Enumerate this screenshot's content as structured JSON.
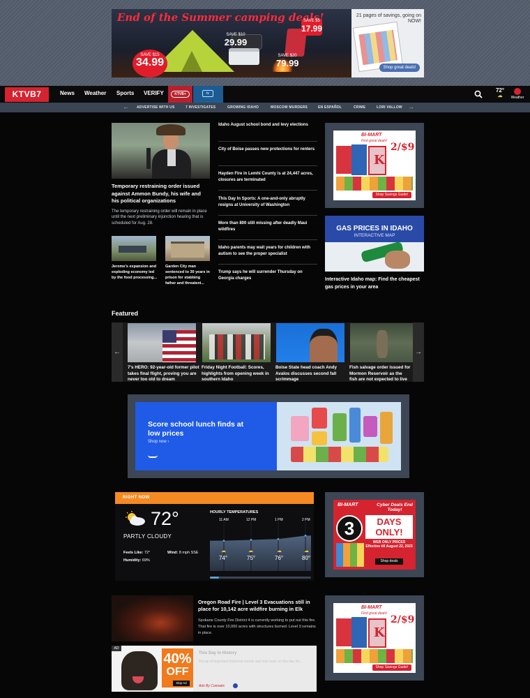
{
  "top_ad": {
    "headline": "End of the Summer camping deals!",
    "prices": [
      {
        "save": "SAVE $15",
        "amount": "34.99"
      },
      {
        "save": "SAVE $10",
        "amount": "29.99"
      },
      {
        "save": "SAVE $20",
        "amount": "79.99"
      },
      {
        "save": "SAVE $5",
        "amount": "17.99"
      }
    ],
    "flyer_text": "21 pages of savings, going on NOW!",
    "flyer_brand": "BI-MART",
    "button": "Shop great deals!"
  },
  "header": {
    "logo": "KTVB7",
    "nav": [
      "News",
      "Weather",
      "Sports",
      "VERIFY"
    ],
    "plus_label": "KTVB+",
    "tv_label": "tv",
    "weather_temp": "72°",
    "weather_app_label": "Weather"
  },
  "subnav": {
    "items": [
      "ADVERTISE WITH US",
      "7 INVESTIGATES",
      "GROWING IDAHO",
      "MOSCOW MURDERS",
      "EN ESPAÑOL",
      "CRIME",
      "LORI VALLOW"
    ]
  },
  "lead_story": {
    "headline": "Temporary restraining order issued against Ammon Bundy, his wife and his political organizations",
    "description": "The temporary restraining order will remain in place until the next preliminary injunction hearing that is scheduled for Aug. 28."
  },
  "small_stories": [
    {
      "caption": "Jerome's expansion and exploding economy led by the food processing..."
    },
    {
      "caption": "Garden City man sentenced to 30 years in prison for stabbing father and threateni..."
    }
  ],
  "headlines": [
    "Idaho August school bond and levy elections",
    "City of Boise passes new protections for renters",
    "Hayden Fire in Lemhi County is at 24,447 acres, closures are terminated",
    "This Day In Sports: A one-and-only abruptly resigns at University of Washington",
    "More than 800 still missing after deadly Maui wildfires",
    "Idaho parents may wait years for children with autism to see the proper specialist",
    "Trump says he will surrender Thursday on Georgia charges"
  ],
  "side_ad_1": {
    "brand": "BI-MART",
    "tagline": "Find great deals!",
    "price": "2/$9",
    "button": "Shop Savings Guide!"
  },
  "gas_ad": {
    "title": "GAS PRICES IN IDAHO",
    "subtitle": "INTERACTIVE MAP",
    "caption": "Interactive Idaho map: Find the cheapest gas prices in your area"
  },
  "featured": {
    "title": "Featured",
    "items": [
      {
        "caption": "7's HERO: 92-year-old former pilot takes final flight, proving you are never too old to dream"
      },
      {
        "caption": "Friday Night Football: Scores, highlights from opening week in southern Idaho"
      },
      {
        "caption": "Boise State head coach Andy Avalos discusses second fall scrimmage"
      },
      {
        "caption": "Fish salvage order issued for Mormon Reservoir as the fish are not expected to live"
      }
    ]
  },
  "amazon_ad": {
    "headline": "Score school lunch finds at low prices",
    "cta": "Shop now ›"
  },
  "weather": {
    "bar_label": "RIGHT NOW",
    "temp": "72°",
    "condition": "PARTLY CLOUDY",
    "feels_like_label": "Feels Like:",
    "feels_like": "72°",
    "wind_label": "Wind:",
    "wind": "8 mph SSE",
    "humidity_label": "Humidity:",
    "humidity": "69%",
    "hourly_title": "HOURLY TEMPERATURES",
    "hours": [
      {
        "time": "11 AM",
        "temp": "74°",
        "value": 74
      },
      {
        "time": "12 PM",
        "temp": "75°",
        "value": 75
      },
      {
        "time": "1 PM",
        "temp": "76°",
        "value": 76
      },
      {
        "time": "2 PM",
        "temp": "80°",
        "value": 80
      }
    ]
  },
  "side_ad_2": {
    "brand": "BI-MART",
    "promo": "Cyber Deals End Today!",
    "days_number": "3",
    "days_text": "DAYS ONLY!",
    "web_text": "WEB ONLY PRICES Effective till August 22, 2023",
    "button": "Shop deals"
  },
  "bottom_story": {
    "headline": "Oregon Road Fire | Level 3 Evacuations still in place for 10,142 acre wildfire burning in Elk",
    "description": "Spokane County Fire District 4 is currently working to put out this fire. That fire is over 10,000 acres with structures burned. Level 3 remains in place."
  },
  "dog_ad": {
    "badge": "AD",
    "percent": "40%",
    "off": "OFF",
    "skip": "Skip Ad"
  },
  "history_box": {
    "title": "This Day in History",
    "desc": "Recap of important historical events and look back on this day for...",
    "ads_by": "Ads By Connatix"
  }
}
